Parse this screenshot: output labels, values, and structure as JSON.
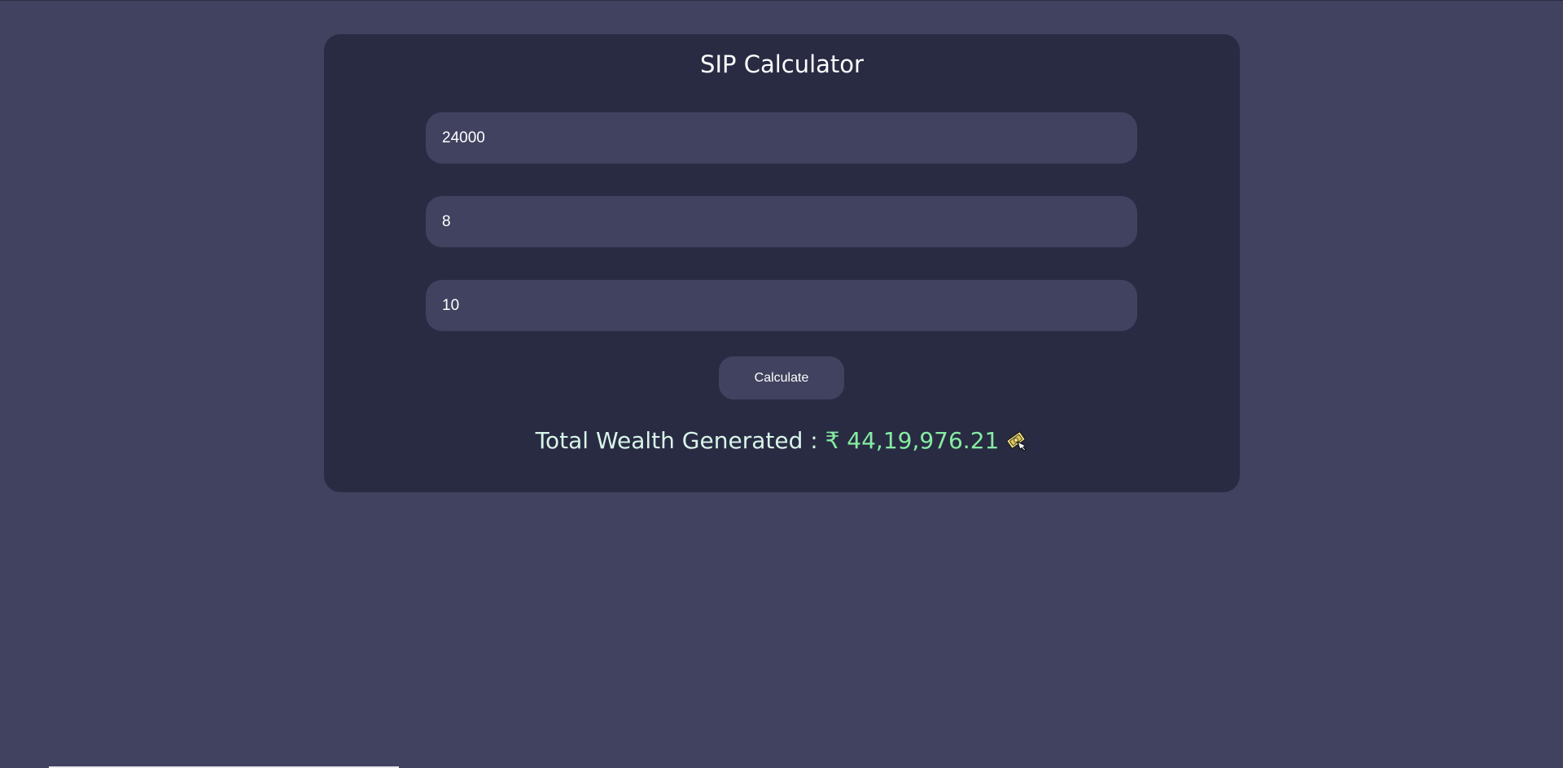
{
  "app": {
    "title": "SIP Calculator"
  },
  "form": {
    "monthly_investment": {
      "value": "24000",
      "placeholder": ""
    },
    "expected_return": {
      "value": "8",
      "placeholder": ""
    },
    "time_period": {
      "value": "10",
      "placeholder": ""
    },
    "calculate_label": "Calculate"
  },
  "result": {
    "label": "Total Wealth Generated : ",
    "value": "₹ 44,19,976.21",
    "icon": "money-with-wings-icon"
  },
  "colors": {
    "page_bg": "#41425f",
    "card_bg": "#292b43",
    "field_bg": "#41425f",
    "result_label": "#d8f5e8",
    "result_value": "#86eca2"
  }
}
